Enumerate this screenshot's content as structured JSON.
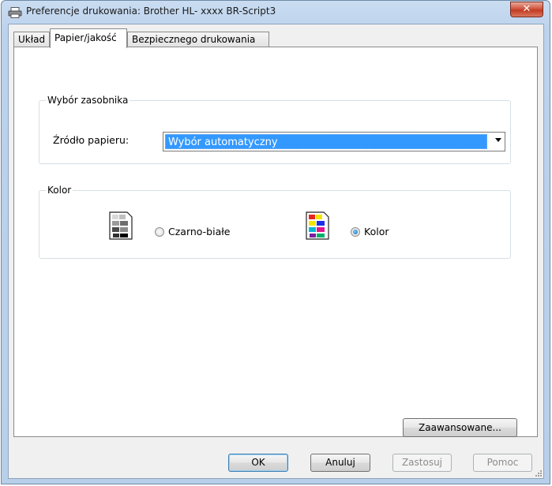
{
  "window": {
    "title": "Preferencje drukowania: Brother HL- xxxx BR-Script3",
    "close_label": "✕"
  },
  "tabs": [
    {
      "label": "Układ",
      "active": false
    },
    {
      "label": "Papier/jakość",
      "active": true
    },
    {
      "label": "Bezpiecznego drukowania",
      "active": false
    }
  ],
  "tray_group": {
    "legend": "Wybór zasobnika",
    "source_label": "Źródło papieru:",
    "source_value": "Wybór automatyczny"
  },
  "color_group": {
    "legend": "Kolor",
    "options": [
      {
        "label": "Czarno-białe",
        "selected": false,
        "icon": "grayscale-page-icon"
      },
      {
        "label": "Kolor",
        "selected": true,
        "icon": "color-page-icon"
      }
    ]
  },
  "buttons": {
    "advanced": "Zaawansowane...",
    "ok": "OK",
    "cancel": "Anuluj",
    "apply": "Zastosuj",
    "help": "Pomoc"
  },
  "colors": {
    "selection": "#3399ff",
    "close_button": "#c94a32",
    "dialog_frame": "#bcd2ec"
  }
}
